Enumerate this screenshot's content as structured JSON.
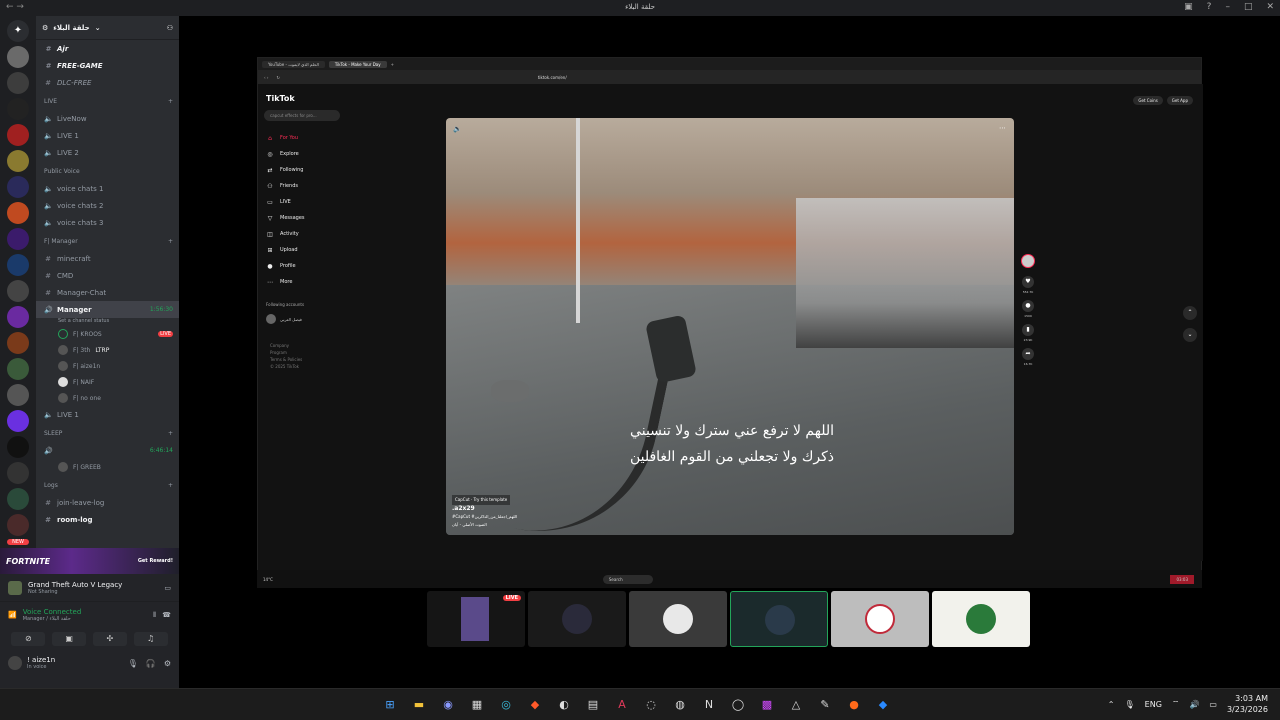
{
  "window": {
    "title": "حلقة البلاء"
  },
  "guild": {
    "name": "حلقة البلاء"
  },
  "channels": [
    {
      "type": "text",
      "name": "Ajr",
      "style": "bold"
    },
    {
      "type": "text",
      "name": "FREE-GAME",
      "style": "bold"
    },
    {
      "type": "text",
      "name": "DLC-FREE",
      "style": "italic"
    }
  ],
  "live_category": "LIVE",
  "live_channels": [
    "LiveNow",
    "LIVE 1",
    "LIVE 2"
  ],
  "public_category": "Public Voice",
  "public_channels": [
    "voice chats 1",
    "voice chats 2",
    "voice chats 3"
  ],
  "manager_category": "F| Manager",
  "manager_channels": [
    "minecraft",
    "CMD",
    "Manager-Chat"
  ],
  "active_voice": {
    "name": "Manager",
    "timer": "1:56:30",
    "status": "Set a channel status"
  },
  "members": [
    {
      "name": "F| KROOS",
      "live": "LIVE"
    },
    {
      "name": "F| 3th",
      "extra": "LTRP"
    },
    {
      "name": "F| aize1n"
    },
    {
      "name": "F| NAIF"
    },
    {
      "name": "F| no one"
    }
  ],
  "manager_live": "LIVE 1",
  "sleep_category": "SLEEP",
  "sleep_timer": "6:46:14",
  "sleep_member": "F| GREEB",
  "logs_category": "Logs",
  "logs_channels": [
    "join-leave-log",
    "room-log"
  ],
  "promo": {
    "title": "FORTNITE",
    "button": "Get Reward!"
  },
  "activity": {
    "game": "Grand Theft Auto V Legacy",
    "state": "Not Sharing"
  },
  "voice": {
    "status": "Voice Connected",
    "where": "Manager / حلقة البلاء"
  },
  "user": {
    "name": "! aize1n",
    "status": "In voice"
  },
  "browser": {
    "tab1": "YouTube - الحلم الذي لايموت",
    "tab2": "TikTok - Make Your Day",
    "url": "tiktok.com/en/"
  },
  "tiktok": {
    "logo": "TikTok",
    "search_placeholder": "capcut effects for pro...",
    "nav": [
      "For You",
      "Explore",
      "Following",
      "Friends",
      "LIVE",
      "Messages",
      "Activity",
      "Upload",
      "Profile",
      "More"
    ],
    "following_label": "Following accounts",
    "following_name": "فيصل العربي",
    "footer": [
      "Company",
      "Program",
      "Terms & Policies",
      "© 2025 TikTok"
    ],
    "get_coins": "Get Coins",
    "get_app": "Get App",
    "caption_line1": "اللهم لا ترفع عني سترك ولا تنسيني",
    "caption_line2": "ذكرك ولا تجعلني من القوم الغافلين",
    "capcut": "CapCut · Try this template",
    "account": ".a2x29",
    "desc": "#CapCut #اللهم_اجعلنا_من_الذاكرين",
    "sound": "الصوت الأصلي - أيان",
    "stats": {
      "likes": "552.7K",
      "comments": "1509",
      "saves": "23.9K",
      "shares": "16.7K"
    }
  },
  "inner_taskbar": {
    "weather": "14°C",
    "search": "Search",
    "clock": "03:03"
  },
  "tiles": [
    {
      "live": "LIVE",
      "color": "#151515"
    },
    {
      "color": "#1a1a1a"
    },
    {
      "color": "#3a3a3a"
    },
    {
      "color": "#1b2a2c"
    },
    {
      "color": "#bdbdbd"
    },
    {
      "color": "#f2f2ec"
    }
  ],
  "taskbar": {
    "lang": "ENG",
    "time": "3:03 AM",
    "date": "3/23/2026"
  }
}
